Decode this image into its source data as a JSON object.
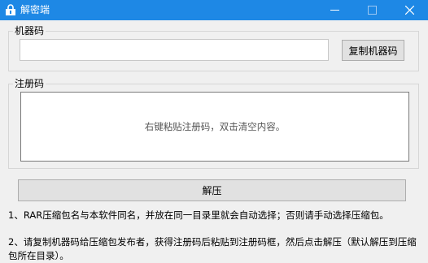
{
  "window": {
    "title": "解密端",
    "buttons": {
      "minimize": "—",
      "maximize": "☐",
      "close": "✕"
    },
    "accent": "#1e88e5"
  },
  "machine_code": {
    "group_label": "机器码",
    "value": "",
    "copy_button": "复制机器码"
  },
  "registration": {
    "group_label": "注册码",
    "hint": "右键粘贴注册码，双击清空内容。"
  },
  "unzip_button": "解压",
  "notes": [
    "1、RAR压缩包名与本软件同名，并放在同一目录里就会自动选择；否则请手动选择压缩包。",
    "2、请复制机器码给压缩包发布者，获得注册码后粘贴到注册码框，然后点击解压（默认解压到压缩包所在目录）。"
  ]
}
